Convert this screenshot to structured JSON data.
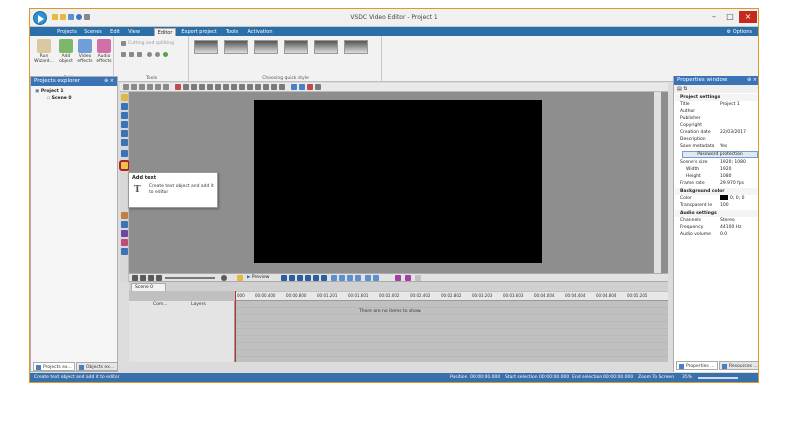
{
  "window": {
    "title": "VSDC Video Editor - Project 1"
  },
  "menu": {
    "items": [
      "Projects",
      "Scenes",
      "Edit",
      "View",
      "Editor",
      "Export project",
      "Tools",
      "Activation"
    ],
    "active": "Editor",
    "options": "Options"
  },
  "ribbon": {
    "run_wizard": "Run Wizard...",
    "add_object": "Add object",
    "video_effects": "Video effects",
    "audio_effects": "Audio effects",
    "editing_label": "Editing",
    "cutting_splitting": "Cutting and splitting",
    "tools_label": "Tools",
    "quick_style_label": "Choosing quick style"
  },
  "projects_explorer": {
    "title": "Projects explorer",
    "project": "Project 1",
    "scene": "Scene 0",
    "tabs": [
      "Projects ex...",
      "Objects ex..."
    ]
  },
  "tooltip": {
    "title": "Add text",
    "description": "Create text object and add it to editor"
  },
  "timeline": {
    "toolbar_preview": "Preview",
    "scene_tab": "Scene 0",
    "col_com": "Com...",
    "col_layers": "Layers",
    "empty_message": "There are no items to show.",
    "ruler": [
      "000",
      "00:00.400",
      "00:00.800",
      "00:01.201",
      "00:01.601",
      "00:02.002",
      "00:02.402",
      "00:02.802",
      "00:03.203",
      "00:03.603",
      "00:04.004",
      "00:04.404",
      "00:04.804",
      "00:05.205"
    ]
  },
  "properties": {
    "title": "Properties window",
    "section_project": "Project settings",
    "rows": [
      {
        "k": "Title",
        "v": "Project 1"
      },
      {
        "k": "Author",
        "v": ""
      },
      {
        "k": "Publisher",
        "v": ""
      },
      {
        "k": "Copyright",
        "v": ""
      },
      {
        "k": "Creation date",
        "v": "22/03/2017"
      },
      {
        "k": "Description",
        "v": ""
      },
      {
        "k": "Save metadata",
        "v": "Yes"
      }
    ],
    "password_button": "Password protection",
    "rows2": [
      {
        "k": "Scene's size",
        "v": "1920; 1080"
      },
      {
        "k": "Width",
        "v": "1920"
      },
      {
        "k": "Height",
        "v": "1080"
      },
      {
        "k": "Frame rate",
        "v": "29.970 fps"
      }
    ],
    "section_background": "Background color",
    "bg_rows": [
      {
        "k": "Color",
        "v": "0; 0; 0"
      },
      {
        "k": "Transparent le",
        "v": "100"
      }
    ],
    "section_audio": "Audio settings",
    "audio_rows": [
      {
        "k": "Channels",
        "v": "Stereo"
      },
      {
        "k": "Frequency",
        "v": "44100 Hz"
      },
      {
        "k": "Audio volume",
        "v": "0.0"
      }
    ],
    "tabs": [
      "Properties ...",
      "Resources ..."
    ]
  },
  "status": {
    "message": "Create text object and add it to editor",
    "position_label": "Position",
    "position_value": "00:00:00.000",
    "start_label": "Start selection",
    "start_value": "00:00:00.000",
    "end_label": "End selection",
    "end_value": "00:00:00.000",
    "zoom_label": "Zoom To Screen",
    "zoom_value": "35%"
  },
  "colors": {
    "accent": "#2b6fa8",
    "panel_header": "#3a73b6",
    "highlight_border": "#b3202a",
    "canvas": "#000000"
  }
}
